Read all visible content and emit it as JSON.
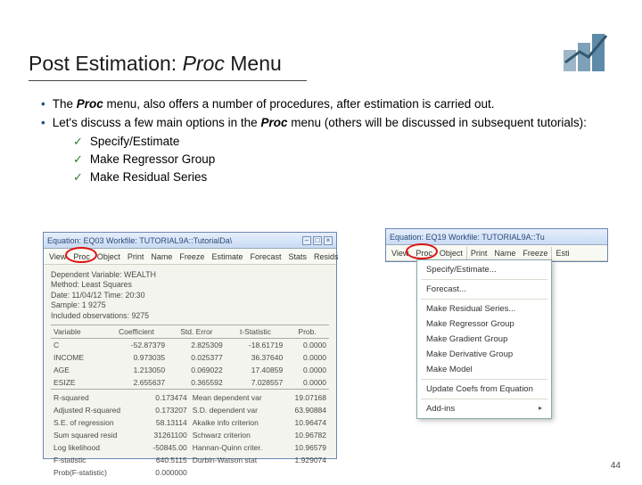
{
  "header": {
    "title_pre": "Post Estimation: ",
    "title_ital": "Proc",
    "title_post": " Menu"
  },
  "bullets": {
    "b1_pre": "The ",
    "b1_bold": "Proc",
    "b1_post": " menu, also offers a number of procedures, after estimation is carried out.",
    "b2_pre": "Let's discuss a few main options in the ",
    "b2_bold": "Proc",
    "b2_post": " menu (others will be discussed in subsequent tutorials):",
    "sub1": "Specify/Estimate",
    "sub2": "Make Regressor Group",
    "sub3": "Make Residual Series"
  },
  "win_left": {
    "title": "Equation: EQ03   Workfile: TUTORIAL9A::TutorialDa\\",
    "toolbar": [
      "View",
      "Proc",
      "Object",
      "Print",
      "Name",
      "Freeze",
      "Estimate",
      "Forecast",
      "Stats",
      "Resids"
    ],
    "info": {
      "depvar": "Dependent Variable: WEALTH",
      "method": "Method: Least Squares",
      "date": "Date: 11/04/12   Time: 20:30",
      "sample": "Sample: 1 9275",
      "incl": "Included observations: 9275"
    },
    "cols": [
      "Variable",
      "Coefficient",
      "Std. Error",
      "t-Statistic",
      "Prob."
    ],
    "rows": [
      [
        "C",
        "-52.87379",
        "2.825309",
        "-18.61719",
        "0.0000"
      ],
      [
        "INCOME",
        "0.973035",
        "0.025377",
        "36.37640",
        "0.0000"
      ],
      [
        "AGE",
        "1.213050",
        "0.069022",
        "17.40859",
        "0.0000"
      ],
      [
        "ESIZE",
        "2.655637",
        "0.365592",
        "7.028557",
        "0.0000"
      ]
    ],
    "stats_left": [
      [
        "R-squared",
        "0.173474"
      ],
      [
        "Adjusted R-squared",
        "0.173207"
      ],
      [
        "S.E. of regression",
        "58.13114"
      ],
      [
        "Sum squared resid",
        "31261100"
      ],
      [
        "Log likelihood",
        "-50845.00"
      ],
      [
        "F-statistic",
        "640.5115"
      ],
      [
        "Prob(F-statistic)",
        "0.000000"
      ]
    ],
    "stats_right": [
      [
        "Mean dependent var",
        "19.07168"
      ],
      [
        "S.D. dependent var",
        "63.90884"
      ],
      [
        "Akaike info criterion",
        "10.96474"
      ],
      [
        "Schwarz criterion",
        "10.96782"
      ],
      [
        "Hannan-Quinn criter.",
        "10.96579"
      ],
      [
        "Durbin-Watson stat",
        "1.929074"
      ]
    ]
  },
  "win_right": {
    "title": "Equation: EQ19   Workfile: TUTORIAL9A::Tu",
    "toolbar": [
      "View",
      "Proc",
      "Object",
      "Print",
      "Name",
      "Freeze",
      "Esti"
    ],
    "menu_items": [
      "Specify/Estimate...",
      "Forecast...",
      "Make Residual Series...",
      "Make Regressor Group",
      "Make Gradient Group",
      "Make Derivative Group",
      "Make Model",
      "Update Coefs from Equation",
      "Add-ins"
    ]
  },
  "pagenum": "44"
}
